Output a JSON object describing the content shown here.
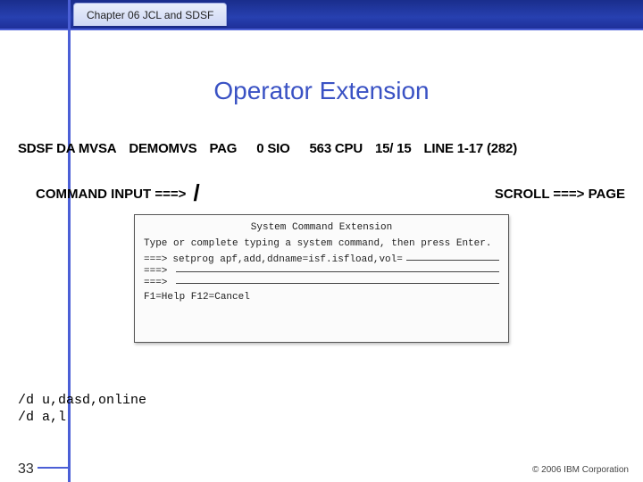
{
  "header": {
    "chapter_tab": "Chapter 06 JCL and SDSF"
  },
  "title": "Operator Extension",
  "sdsf_line": {
    "prefix": "SDSF DA MVSA",
    "system": "DEMOMVS",
    "pag_label": "PAG",
    "sio": "0 SIO",
    "cpu": "563 CPU",
    "ratio": "15/ 15",
    "line": "LINE 1-17 (282)"
  },
  "command": {
    "label": "COMMAND INPUT ===>",
    "slash": "/",
    "scroll": "SCROLL ===> PAGE"
  },
  "panel": {
    "title": "System Command Extension",
    "instruction": "Type or complete typing a system command, then press Enter.",
    "arrow": "===>",
    "cmd_text": "setprog apf,add,ddname=isf.isfload,vol=",
    "fkeys": "F1=Help  F12=Cancel"
  },
  "example_cmds": {
    "line1": "/d  u,dasd,online",
    "line2": "/d a,l"
  },
  "footer": {
    "page": "33",
    "copyright": "© 2006 IBM Corporation"
  }
}
